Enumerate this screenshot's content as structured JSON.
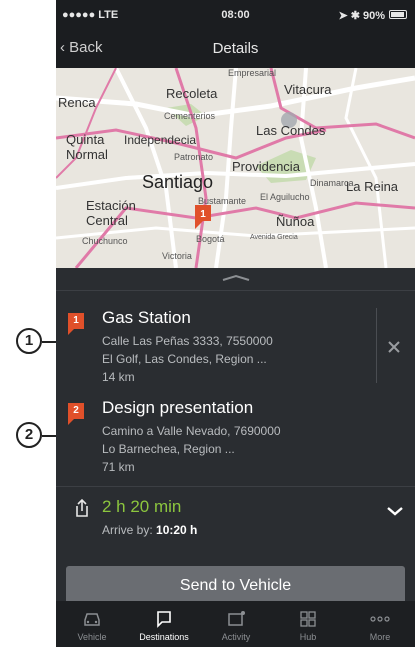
{
  "status_bar": {
    "carrier": "●●●●● LTE",
    "time": "08:00",
    "indicators": "➤ ✱ 90%"
  },
  "nav": {
    "back_label": "‹ Back",
    "title": "Details"
  },
  "map": {
    "labels": {
      "empresarial": "Empresarial",
      "renca": "Renca",
      "recoleta": "Recoleta",
      "vitacura": "Vitacura",
      "cementerios": "Cementerios",
      "quinta_normal": "Quinta\nNormal",
      "independencia": "Independecia",
      "las_condes": "Las Condes",
      "patronato": "Patronato",
      "providencia": "Providencia",
      "santiago": "Santiago",
      "dinamarca": "Dinamarca",
      "la_reina": "La Reina",
      "bustamante": "Bustamante",
      "el_aguilucho": "El Aguilucho",
      "estacion_central": "Estación\nCentral",
      "nunoa": "Ñuñoa",
      "chuchunco": "Chuchunco",
      "bogota": "Bogotá",
      "avenida_grecia": "Avenida Grecia",
      "victoria": "Victoria"
    },
    "pin_number": "1",
    "colors": {
      "land": "#e9e6df",
      "major_road": "#e07aa8",
      "road": "#ffffff",
      "park": "#c9dcb4"
    }
  },
  "destinations": [
    {
      "number": "1",
      "title": "Gas Station",
      "address_1": "Calle Las Peñas 3333, 7550000",
      "address_2": "El Golf, Las Condes, Region ...",
      "distance": "14 km"
    },
    {
      "number": "2",
      "title": "Design presentation",
      "address_1": "Camino a Valle Nevado, 7690000",
      "address_2": "Lo Barnechea, Region ...",
      "distance": "71 km"
    }
  ],
  "route": {
    "duration": "2 h 20 min",
    "arrive_prefix": "Arrive by:",
    "arrive_time": "10:20 h"
  },
  "send_button": "Send to Vehicle",
  "tabs": [
    {
      "label": "Vehicle",
      "icon": "car-icon"
    },
    {
      "label": "Destinations",
      "icon": "destinations-flag-icon"
    },
    {
      "label": "Activity",
      "icon": "activity-icon"
    },
    {
      "label": "Hub",
      "icon": "hub-grid-icon"
    },
    {
      "label": "More",
      "icon": "more-dots-icon"
    }
  ],
  "callouts": [
    "1",
    "2"
  ],
  "accent": {
    "orange": "#e0502a",
    "green": "#8cc63e"
  }
}
